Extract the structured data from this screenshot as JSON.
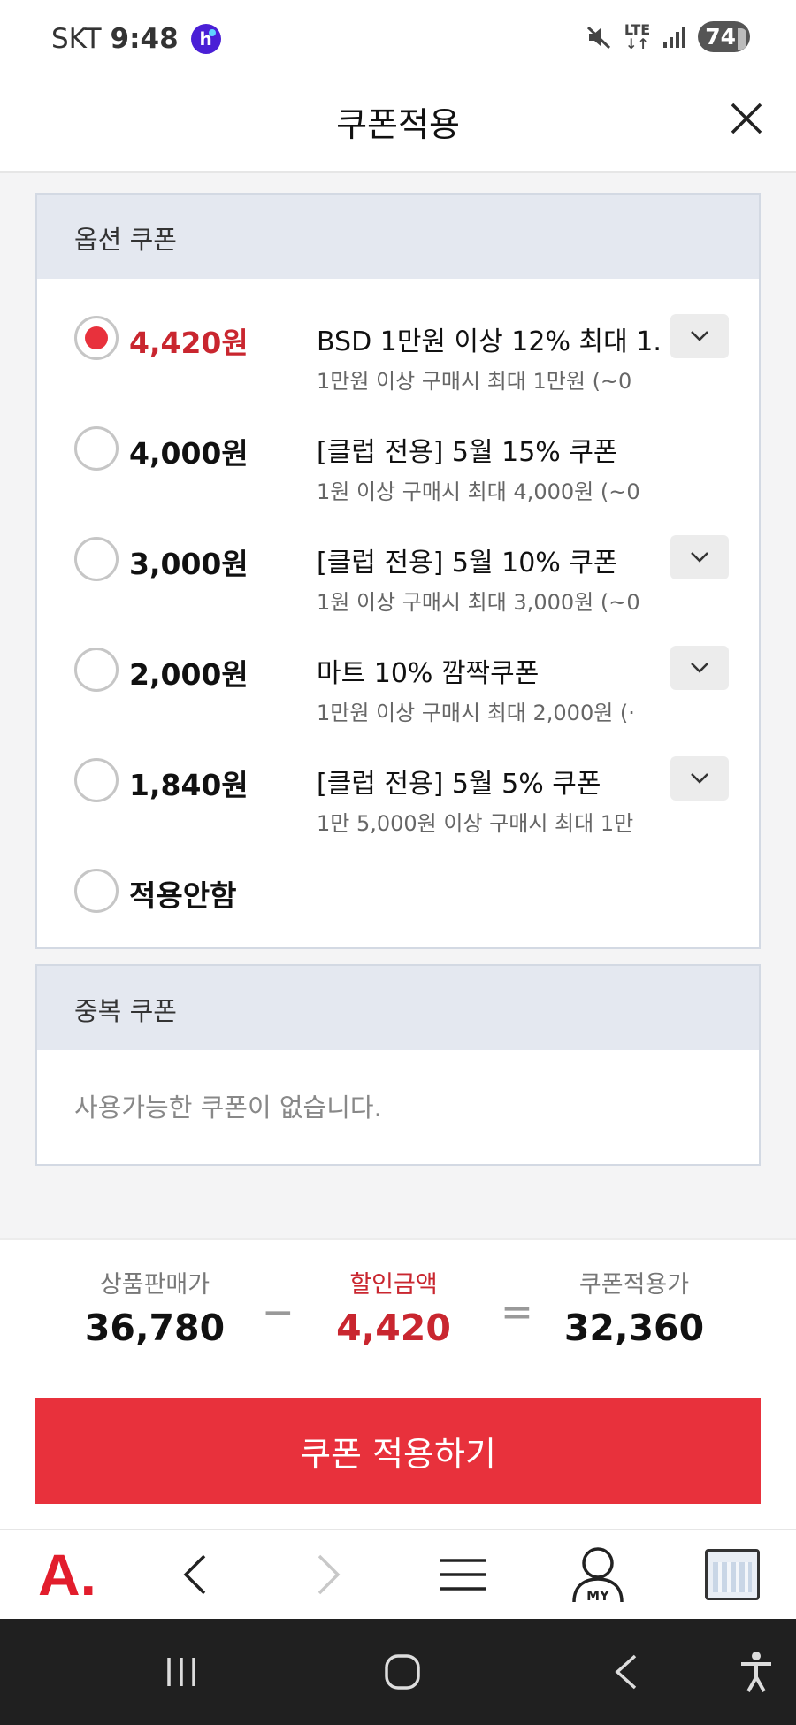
{
  "status_bar": {
    "carrier": "SKT",
    "time": "9:48",
    "app_badge": "h",
    "network": "LTE",
    "battery": "74"
  },
  "header": {
    "title": "쿠폰적용",
    "close_icon": "close-icon"
  },
  "option_coupons": {
    "heading": "옵션 쿠폰",
    "items": [
      {
        "amount": "4,420원",
        "title": "BSD 1만원 이상 12% 최대 1...",
        "desc": "1만원 이상 구매시 최대 1만원 (~0",
        "selected": true,
        "expandable": true
      },
      {
        "amount": "4,000원",
        "title": "[클럽 전용] 5월 15% 쿠폰",
        "desc": "1원 이상 구매시 최대 4,000원 (~0",
        "selected": false,
        "expandable": false
      },
      {
        "amount": "3,000원",
        "title": "[클럽 전용] 5월 10% 쿠폰",
        "desc": "1원 이상 구매시 최대 3,000원 (~0",
        "selected": false,
        "expandable": true
      },
      {
        "amount": "2,000원",
        "title": "마트 10% 깜짝쿠폰",
        "desc": "1만원 이상 구매시 최대 2,000원 (·",
        "selected": false,
        "expandable": true
      },
      {
        "amount": "1,840원",
        "title": "[클럽 전용] 5월 5% 쿠폰",
        "desc": "1만 5,000원 이상 구매시 최대 1만",
        "selected": false,
        "expandable": true
      }
    ],
    "none_label": "적용안함"
  },
  "duplicate_coupons": {
    "heading": "중복 쿠폰",
    "empty_text": "사용가능한 쿠폰이 없습니다."
  },
  "summary": {
    "price_label": "상품판매가",
    "price_value": "36,780",
    "minus": "−",
    "discount_label": "할인금액",
    "discount_value": "4,420",
    "equals": "=",
    "final_label": "쿠폰적용가",
    "final_value": "32,360"
  },
  "apply_button": "쿠폰 적용하기",
  "bottom_nav": {
    "logo": "A.",
    "my_label": "MY"
  },
  "colors": {
    "accent": "#e8313c",
    "accent_text": "#c9262f",
    "panel_head": "#e4e8f0"
  }
}
